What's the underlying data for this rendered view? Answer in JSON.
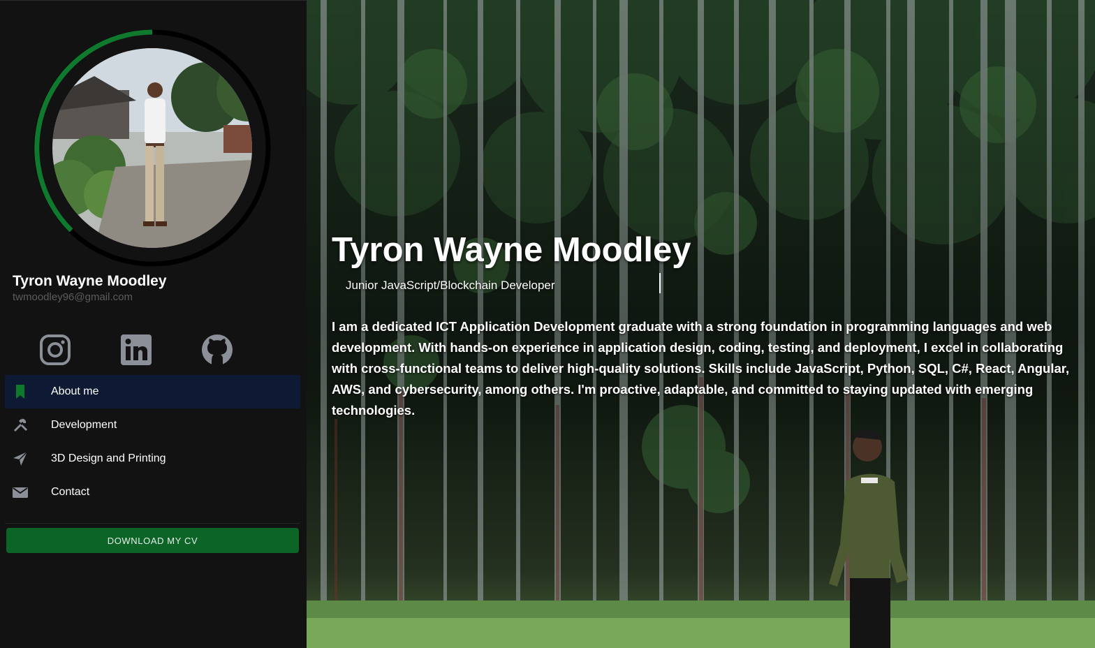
{
  "profile": {
    "name": "Tyron Wayne Moodley",
    "email": "twmoodley96@gmail.com"
  },
  "social": [
    {
      "name": "instagram",
      "icon": "instagram-icon"
    },
    {
      "name": "linkedin",
      "icon": "linkedin-icon"
    },
    {
      "name": "github",
      "icon": "github-icon"
    }
  ],
  "nav": {
    "items": [
      {
        "label": "About me",
        "icon": "bookmark-icon",
        "active": true
      },
      {
        "label": "Development",
        "icon": "tools-icon",
        "active": false
      },
      {
        "label": "3D Design and Printing",
        "icon": "send-icon",
        "active": false
      },
      {
        "label": "Contact",
        "icon": "mail-icon",
        "active": false
      }
    ]
  },
  "cv_button": {
    "label": "DOWNLOAD MY CV"
  },
  "hero": {
    "title": "Tyron Wayne Moodley",
    "subtitle": "Junior JavaScript/Blockchain Developer",
    "bio": "I am a dedicated ICT Application Development graduate with a strong foundation in programming languages and web development. With hands-on experience in application design, coding, testing, and deployment, I excel in collaborating with cross-functional teams to deliver high-quality solutions. Skills include JavaScript, Python, SQL, C#, React, Angular, AWS, and cybersecurity, among others. I'm proactive, adaptable, and committed to staying updated with emerging technologies."
  },
  "colors": {
    "accent_green": "#0c6427",
    "ring_green": "#0f7a2e",
    "active_nav": "#0e1a33",
    "sidebar_bg": "#121212",
    "icon_gray": "#8a8f98"
  }
}
